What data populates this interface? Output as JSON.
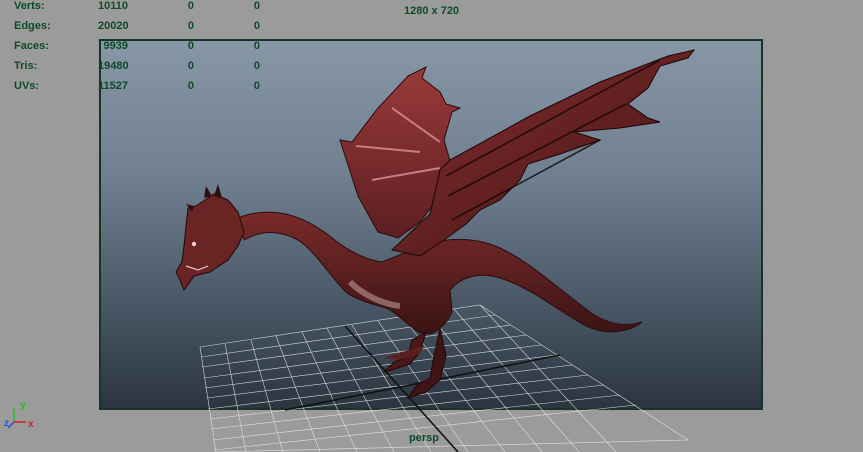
{
  "heads_up": {
    "rows": [
      {
        "label": "Verts:",
        "total": "10110",
        "selected": "0",
        "components": "0"
      },
      {
        "label": "Edges:",
        "total": "20020",
        "selected": "0",
        "components": "0"
      },
      {
        "label": "Faces:",
        "total": "9939",
        "selected": "0",
        "components": "0"
      },
      {
        "label": "Tris:",
        "total": "19480",
        "selected": "0",
        "components": "0"
      },
      {
        "label": "UVs:",
        "total": "11527",
        "selected": "0",
        "components": "0"
      }
    ]
  },
  "resolution_gate": "1280 x 720",
  "camera": "persp",
  "axis": {
    "x": "x",
    "y": "y",
    "z": "z"
  },
  "colors": {
    "hud_text": "#0e4a28",
    "gate_border": "#16342a",
    "dragon": "#5a1c1c",
    "axis_x": "#d02020",
    "axis_y": "#20c020",
    "axis_z": "#3050e0"
  }
}
